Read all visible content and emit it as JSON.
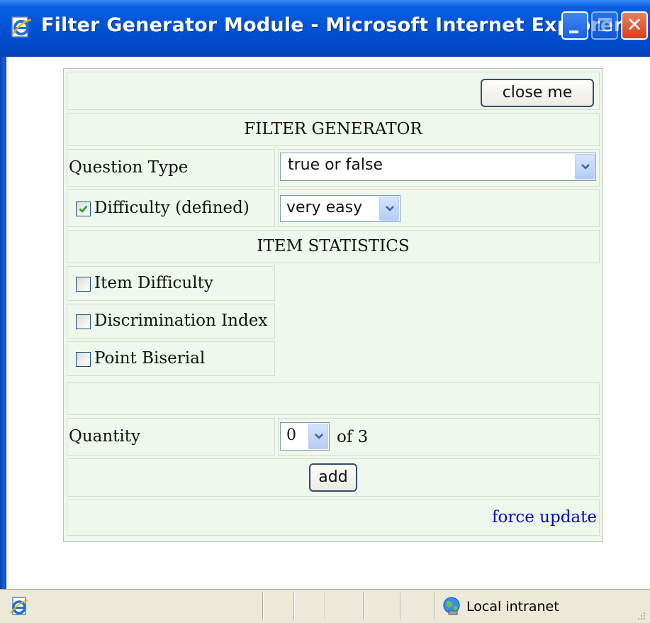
{
  "window": {
    "title": "Filter Generator Module - Microsoft Internet Explorer",
    "icons": {
      "app": "ie-page-icon",
      "minimize": "minimize-icon",
      "maximize": "maximize-icon",
      "close": "close-icon"
    },
    "close_glyph": "✕"
  },
  "form": {
    "close_button": "close me",
    "filter_header": "FILTER GENERATOR",
    "question_type": {
      "label": "Question Type",
      "selected": "true or false"
    },
    "difficulty": {
      "label": "Difficulty (defined)",
      "checked": true,
      "selected": "very easy"
    },
    "stats_header": "ITEM STATISTICS",
    "stats": [
      {
        "label": "Item Difficulty",
        "checked": false
      },
      {
        "label": "Discrimination Index",
        "checked": false
      },
      {
        "label": "Point Biserial",
        "checked": false
      }
    ],
    "quantity": {
      "label": "Quantity",
      "selected": "0",
      "of_text": "of 3"
    },
    "add_button": "add",
    "force_update": "force update"
  },
  "statusbar": {
    "zone": "Local intranet",
    "zone_icon": "local-intranet-icon",
    "page_icon": "ie-page-icon"
  },
  "colors": {
    "title_bar": "#0052d6",
    "form_bg": "#eef8ec",
    "link": "#0000cc",
    "status_bg": "#ece9d8"
  }
}
